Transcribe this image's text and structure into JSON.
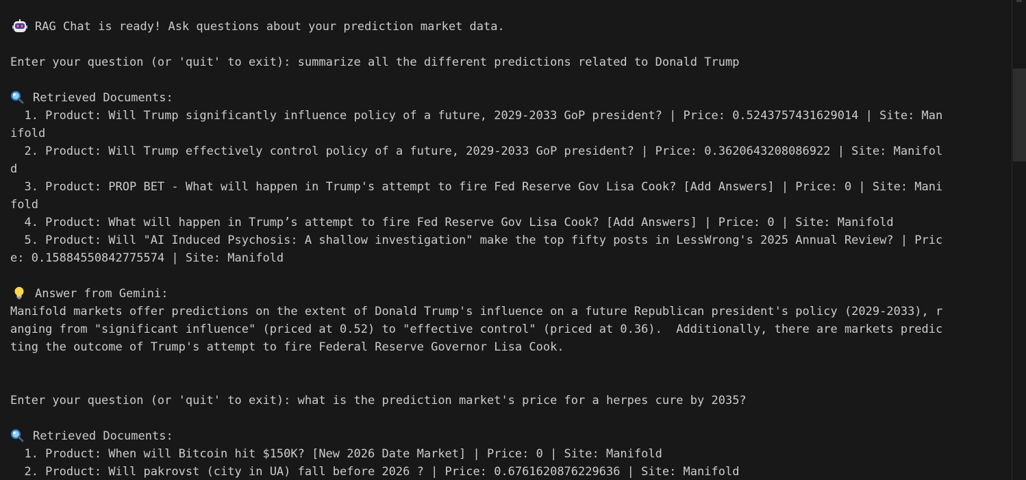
{
  "terminal": {
    "ready": "RAG Chat is ready! Ask questions about your prediction market data.",
    "prompt1": "Enter your question (or 'quit' to exit): summarize all the different predictions related to Donald Trump",
    "retrieved1_header": "Retrieved Documents:",
    "retrieved1": [
      [
        "  1. Product: Will Trump significantly influence policy of a future, 2029-2033 GoP president? | Price: 0.5243757431629014 | Site: Man",
        "ifold"
      ],
      [
        "  2. Product: Will Trump effectively control policy of a future, 2029-2033 GoP president? | Price: 0.3620643208086922 | Site: Manifol",
        "d"
      ],
      [
        "  3. Product: PROP BET - What will happen in Trump's attempt to fire Fed Reserve Gov Lisa Cook? [Add Answers] | Price: 0 | Site: Mani",
        "fold"
      ],
      [
        "  4. Product: What will happen in Trump’s attempt to fire Fed Reserve Gov Lisa Cook? [Add Answers] | Price: 0 | Site: Manifold"
      ],
      [
        "  5. Product: Will \"AI Induced Psychosis: A shallow investigation\" make the top fifty posts in LessWrong's 2025 Annual Review? | Pric",
        "e: 0.15884550842775574 | Site: Manifold"
      ]
    ],
    "answer_header": "Answer from Gemini:",
    "answer": [
      "Manifold markets offer predictions on the extent of Donald Trump's influence on a future Republican president's policy (2029-2033), r",
      "anging from \"significant influence\" (priced at 0.52) to \"effective control\" (priced at 0.36).  Additionally, there are markets predic",
      "ting the outcome of Trump's attempt to fire Federal Reserve Governor Lisa Cook."
    ],
    "prompt2": "Enter your question (or 'quit' to exit): what is the prediction market's price for a herpes cure by 2035?",
    "retrieved2_header": "Retrieved Documents:",
    "retrieved2": [
      "  1. Product: When will Bitcoin hit $150K? [New 2026 Date Market] | Price: 0 | Site: Manifold",
      "  2. Product: Will pakrovst (city in UA) fall before 2026 ? | Price: 0.6761620876229636 | Site: Manifold"
    ]
  },
  "icons": {
    "ready": "robot-icon",
    "retrieved": "magnifier-icon",
    "answer": "lightbulb-icon"
  },
  "colors": {
    "background": "#181818",
    "text": "#cccccc"
  }
}
